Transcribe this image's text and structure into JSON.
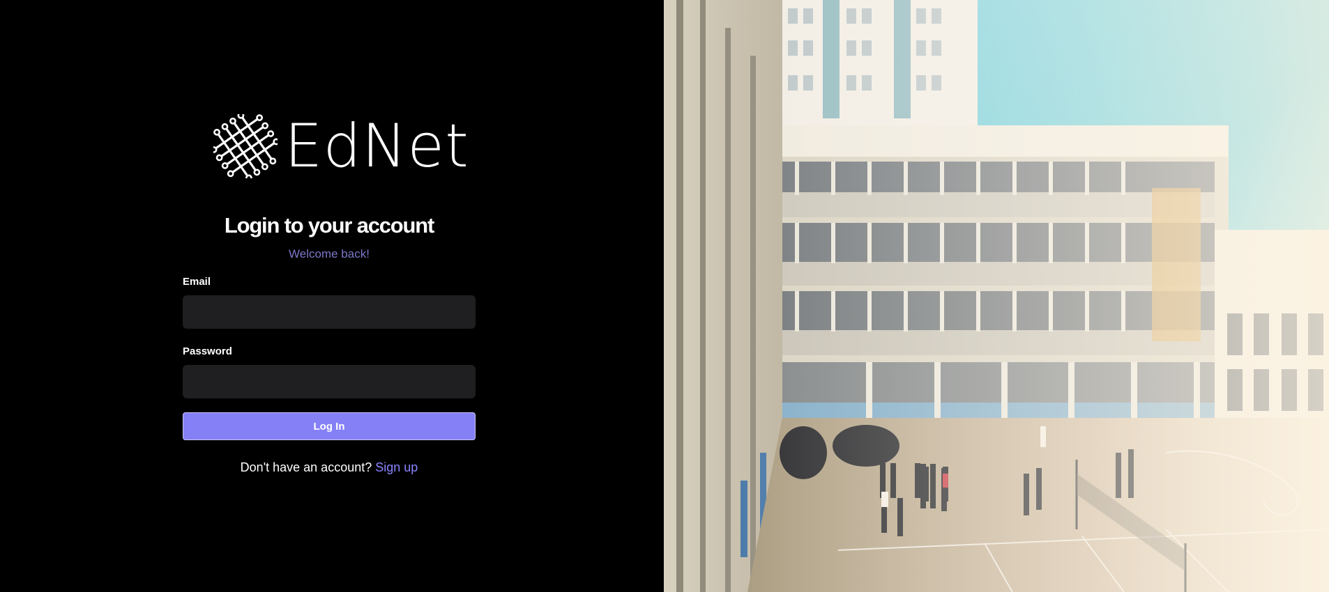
{
  "brand": {
    "name": "EdNet"
  },
  "login": {
    "title": "Login to your account",
    "subtitle": "Welcome back!",
    "email_label": "Email",
    "email_value": "",
    "password_label": "Password",
    "password_value": "",
    "submit_label": "Log In",
    "signup_prompt": "Don't have an account?",
    "signup_link": "Sign up"
  },
  "colors": {
    "background": "#000000",
    "accent": "#8680f7",
    "subtitle": "#7c78c8",
    "input_bg": "#1f1f21"
  },
  "hero_image": {
    "icon": "school-courtyard-photo"
  }
}
